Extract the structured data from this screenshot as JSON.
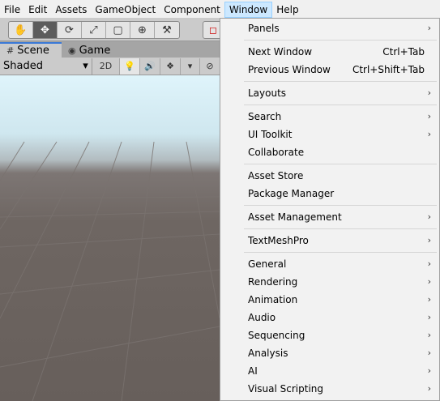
{
  "menubar": {
    "items": [
      "File",
      "Edit",
      "Assets",
      "GameObject",
      "Component",
      "Window",
      "Help"
    ]
  },
  "toolbar": {
    "tools": [
      "hand-tool",
      "move-tool",
      "rotate-tool",
      "scale-tool",
      "rect-tool",
      "transform-tool",
      "custom-tool"
    ],
    "tool_glyphs": [
      "✋",
      "✥",
      "⟳",
      "⤢",
      "▢",
      "⊕",
      "⚒"
    ],
    "selected_tool": "move-tool"
  },
  "tabs": {
    "scene": "Scene",
    "game": "Game"
  },
  "scene_toolbar": {
    "shading_mode": "Shaded",
    "mode_2d": "2D"
  },
  "window_menu": {
    "panels": "Panels",
    "next_window": "Next Window",
    "next_window_shortcut": "Ctrl+Tab",
    "previous_window": "Previous Window",
    "previous_window_shortcut": "Ctrl+Shift+Tab",
    "layouts": "Layouts",
    "search": "Search",
    "ui_toolkit": "UI Toolkit",
    "collaborate": "Collaborate",
    "asset_store": "Asset Store",
    "package_manager": "Package Manager",
    "asset_management": "Asset Management",
    "textmeshpro": "TextMeshPro",
    "general": "General",
    "rendering": "Rendering",
    "animation": "Animation",
    "audio": "Audio",
    "sequencing": "Sequencing",
    "analysis": "Analysis",
    "ai": "AI",
    "visual_scripting": "Visual Scripting",
    "submenu_arrow": "›"
  },
  "colors": {
    "menu_highlight": "#cce8ff",
    "tab_accent": "#3a79d7",
    "sky": "#dff4fb",
    "ground": "#675f5b"
  }
}
